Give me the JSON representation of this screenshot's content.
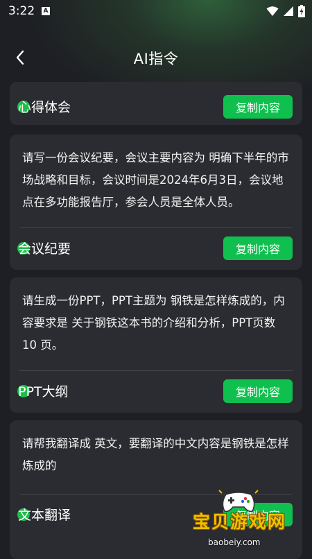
{
  "status_bar": {
    "time": "3:22",
    "notification_icon": "A"
  },
  "header": {
    "title": "AI指令",
    "back_icon": "chevron-left-icon"
  },
  "colors": {
    "accent_green": "#10c04f",
    "card_bg": "#2b2c31",
    "page_bg": "#1e1f24"
  },
  "cards": [
    {
      "title": "心得体会",
      "button": "复制内容",
      "description": ""
    },
    {
      "title": "会议纪要",
      "button": "复制内容",
      "description": "请写一份会议纪要，会议主要内容为 明确下半年的市场战略和目标，会议时间是2024年6月3日，会议地点在多功能报告厅，参会人员是全体人员。"
    },
    {
      "title": "PPT大纲",
      "button": "复制内容",
      "description": "请生成一份PPT，PPT主题为 钢铁是怎样炼成的，内容要求是 关于钢铁这本书的介绍和分析，PPT页数 10 页。"
    },
    {
      "title": "文本翻译",
      "button": "复制内容",
      "description": "请帮我翻译成 英文，要翻译的中文内容是钢铁是怎样炼成的"
    }
  ],
  "watermark": {
    "text": "宝贝游戏网",
    "url": "baobeiy.com"
  }
}
